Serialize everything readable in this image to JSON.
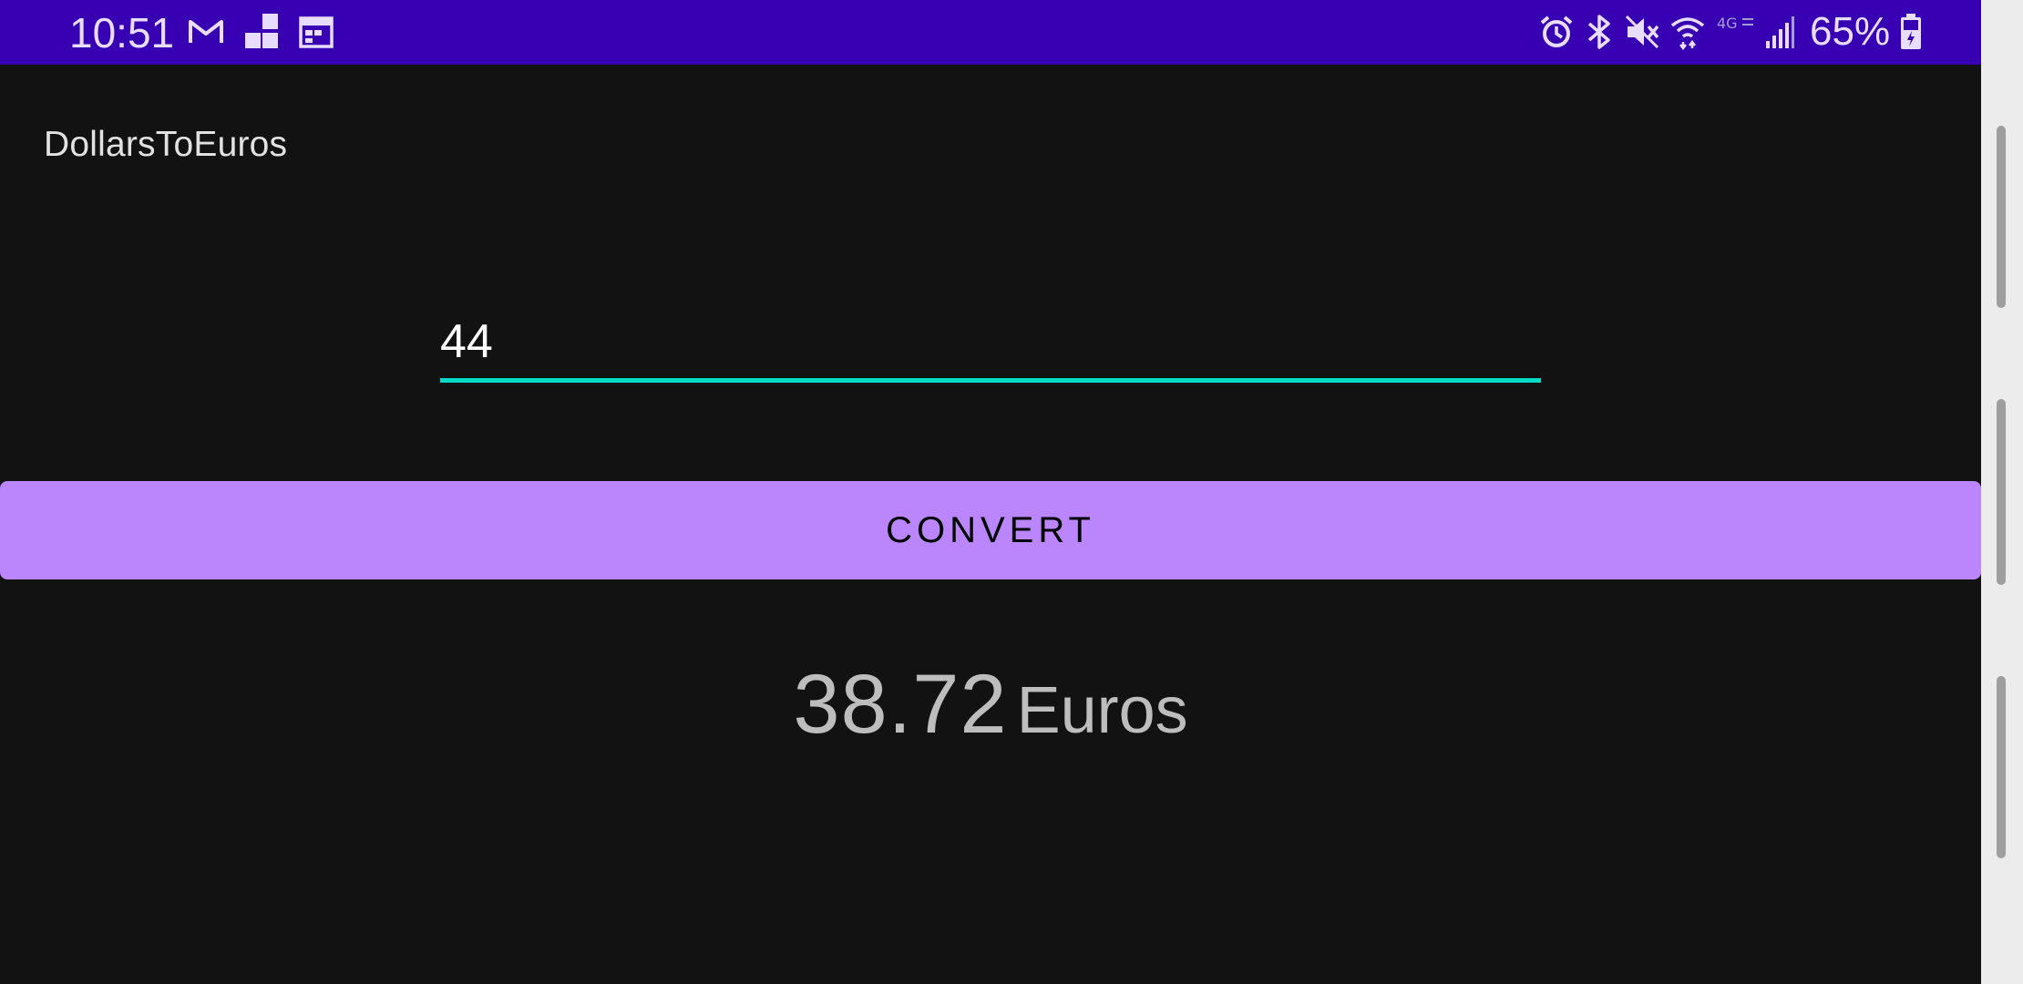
{
  "status_bar": {
    "time": "10:51",
    "battery_percent": "65%",
    "notification_icons": [
      "gmail-icon",
      "widget-blocks-icon",
      "calendar-icon"
    ],
    "system_icons": [
      "alarm-icon",
      "bluetooth-icon",
      "mute-icon",
      "wifi-icon",
      "lte-icon",
      "signal-icon",
      "battery-icon"
    ],
    "background_color": "#3700b3"
  },
  "app": {
    "title": "DollarsToEuros"
  },
  "amount_input": {
    "value": "44",
    "accent_color": "#03dac5"
  },
  "convert_button": {
    "label": "CONVERT",
    "color": "#bb86fc"
  },
  "result": {
    "value": "38.72",
    "unit": "Euros"
  }
}
